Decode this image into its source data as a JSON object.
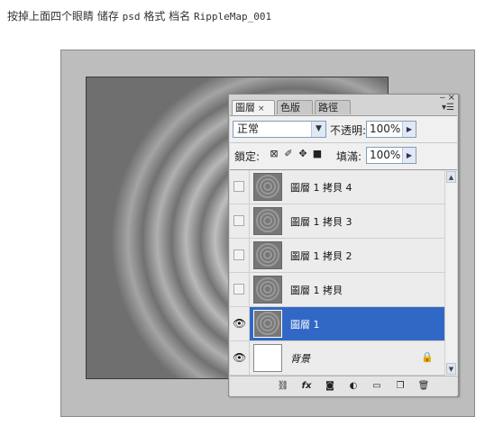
{
  "instruction": {
    "prefix": "按掉上面四个眼睛 储存",
    "ext": "psd",
    "mid": "格式 档名",
    "filename": "RippleMap_001"
  },
  "panel": {
    "tabs": [
      {
        "label": "圖層",
        "active": true,
        "close": "×"
      },
      {
        "label": "色版",
        "active": false
      },
      {
        "label": "路徑",
        "active": false
      }
    ],
    "minimize": "‒",
    "close": "×",
    "menu": "▾☰",
    "blend_mode": "正常",
    "opacity_label": "不透明:",
    "opacity_value": "100%",
    "lock_label": "鎖定:",
    "fill_label": "填滿:",
    "fill_value": "100%",
    "layers": [
      {
        "name": "圖層 1 拷貝 4",
        "visible": false,
        "selected": false
      },
      {
        "name": "圖層 1 拷貝 3",
        "visible": false,
        "selected": false
      },
      {
        "name": "圖層 1 拷貝 2",
        "visible": false,
        "selected": false
      },
      {
        "name": "圖層 1 拷貝",
        "visible": false,
        "selected": false
      },
      {
        "name": "圖層 1",
        "visible": true,
        "selected": true
      },
      {
        "name": "背景",
        "visible": true,
        "selected": false,
        "locked": true
      }
    ],
    "footer_icons": [
      "link-icon",
      "fx-icon",
      "mask-icon",
      "adjustment-icon",
      "folder-icon",
      "new-layer-icon",
      "trash-icon"
    ],
    "fx_label": "fx"
  },
  "colors": {
    "selection": "#3168c6",
    "canvas_bg": "#6f6f6f",
    "stage_bg": "#bdbdbd"
  }
}
